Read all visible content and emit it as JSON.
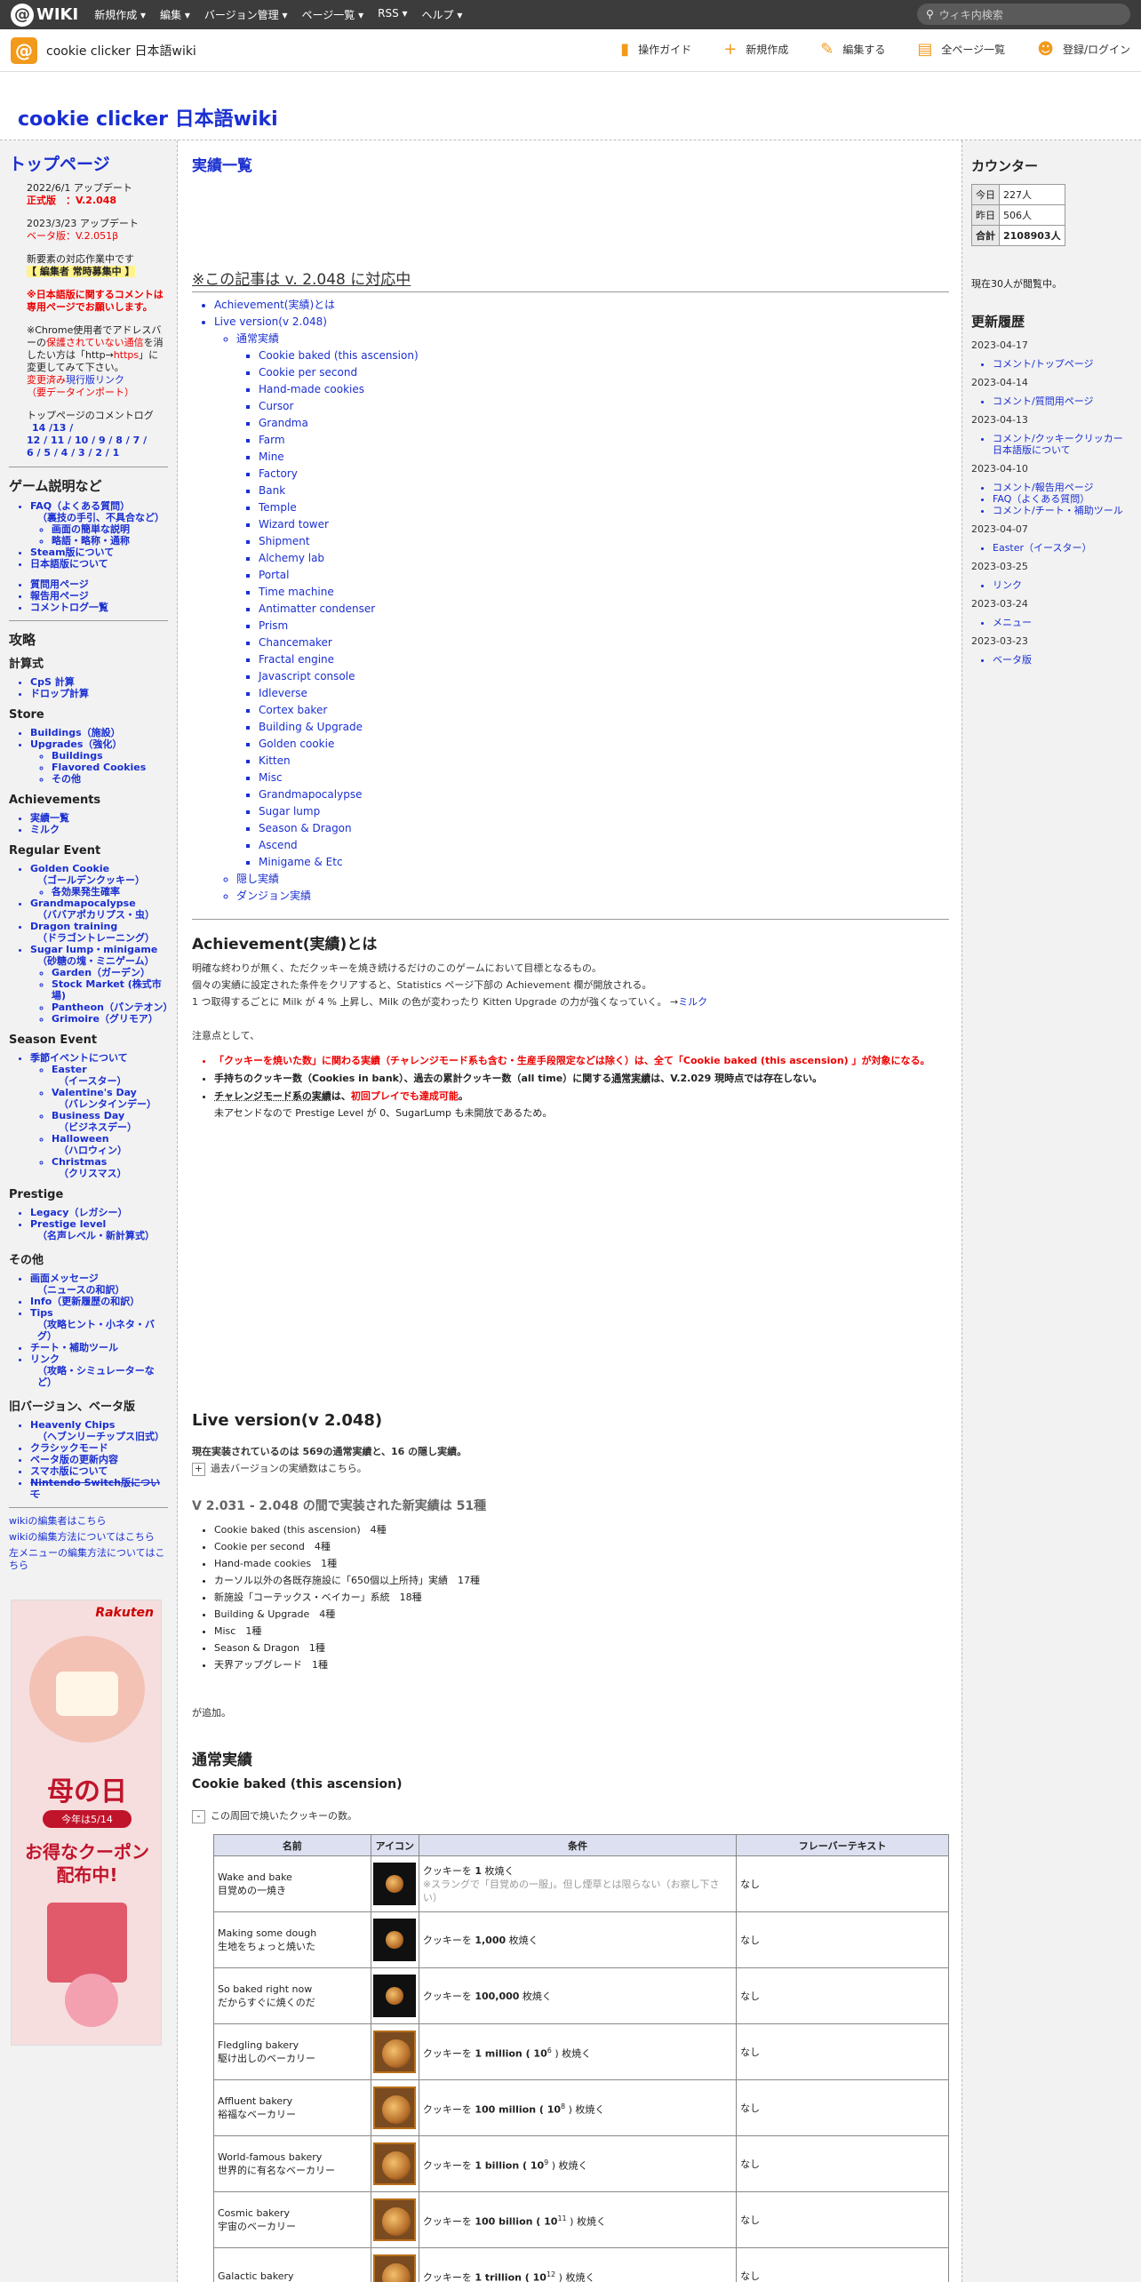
{
  "topbar": {
    "logo": "WIKI",
    "menus": [
      "新規作成 ▾",
      "編集 ▾",
      "バージョン管理 ▾",
      "ページ一覧 ▾",
      "RSS ▾",
      "ヘルプ ▾"
    ],
    "search_placeholder": "ウィキ内検索"
  },
  "sitebar": {
    "name": "cookie clicker 日本語wiki",
    "tools": [
      "操作ガイド",
      "新規作成",
      "編集する",
      "全ページ一覧",
      "登録/ログイン"
    ]
  },
  "header_title": "cookie clicker 日本語wiki",
  "left": {
    "top_title": "トップページ",
    "update1": "2022/6/1 アップデート",
    "official": "正式版　：V.2.048",
    "update2": "2023/3/23 アップデート",
    "beta": "ベータ版：V.2.051β",
    "new_elem": "新要素の対応作業中です",
    "editor": "【 編集者 常時募集中 】",
    "jp_comment": "※日本語版に関するコメントは専用ページでお願いします。",
    "chrome1": "※Chrome使用者でアドレスバーの",
    "chrome_red": "保護されていない通信",
    "chrome2": "を消したい方は「http→",
    "chrome_https": "https",
    "chrome3": "」に変更してみて下さい。",
    "changed": "変更済み",
    "current_link": "現行版リンク",
    "data_import": "（要データインポート）",
    "comment_log": "トップページのコメントログ",
    "log1": "14 /13 /",
    "log2": "12 / 11 / 10 / 9 / 8 / 7 /",
    "log3": "6 / 5 / 4 / 3 / 2 / 1",
    "game_title": "ゲーム説明など",
    "faq": "FAQ（よくある質問）",
    "faq_sub": "（裏技の手引、不具合など）",
    "faq_children": [
      "画面の簡単な説明",
      "略語・略称・通称"
    ],
    "game_items": [
      "Steam版について",
      "日本語版について"
    ],
    "help_items": [
      "質問用ページ",
      "報告用ページ",
      "コメントログ一覧"
    ],
    "strategy": "攻略",
    "calc": "計算式",
    "calc_items": [
      "CpS 計算",
      "ドロップ計算"
    ],
    "store": "Store",
    "store_items": [
      "Buildings（施設）",
      "Upgrades（強化）"
    ],
    "store_children": [
      "Buildings",
      "Flavored Cookies",
      "その他"
    ],
    "achievements": "Achievements",
    "ach_items": [
      "実績一覧",
      "ミルク"
    ],
    "regular": "Regular Event",
    "golden": "Golden Cookie",
    "golden_sub": "（ゴールデンクッキー）",
    "golden_child": "各効果発生確率",
    "grandma": "Grandmapocalypse",
    "grandma_sub": "（ババアポカリプス・虫）",
    "dragon": "Dragon training",
    "dragon_sub": "（ドラゴントレーニング）",
    "sugar": "Sugar lump・minigame",
    "sugar_sub": "（砂糖の塊・ミニゲーム）",
    "sugar_children": [
      "Garden（ガーデン）",
      "Stock Market (株式市場)",
      "Pantheon（パンテオン）",
      "Grimoire（グリモア）"
    ],
    "season": "Season Event",
    "season_item": "季節イベントについて",
    "season_children": [
      {
        "en": "Easter",
        "jp": "（イースター）"
      },
      {
        "en": "Valentine's Day",
        "jp": "（バレンタインデー）"
      },
      {
        "en": "Business Day",
        "jp": "（ビジネスデー）"
      },
      {
        "en": "Halloween",
        "jp": "（ハロウィン）"
      },
      {
        "en": "Christmas",
        "jp": "（クリスマス）"
      }
    ],
    "prestige": "Prestige",
    "legacy": "Legacy（レガシー）",
    "plevel": "Prestige level",
    "plevel_sub": "（名声レベル・新計算式）",
    "other": "その他",
    "screen_msg": "画面メッセージ",
    "screen_msg_sub": "（ニュースの和訳）",
    "info": "Info（更新履歴の和訳）",
    "tips": "Tips",
    "tips_sub": "（攻略ヒント・小ネタ・バグ）",
    "cheat": "チート・補助ツール",
    "link": "リンク",
    "link_sub": "（攻略・シミュレーターなど）",
    "old": "旧バージョン、ベータ版",
    "heavenly": "Heavenly Chips",
    "heavenly_sub": "（ヘブンリーチップス旧式）",
    "old_items": [
      "クラシックモード",
      "ベータ版の更新内容",
      "スマホ版について"
    ],
    "switch": "Nintendo Switch版について",
    "edit1": "wikiの編集者はこちら",
    "edit2": "wikiの編集方法についてはこちら",
    "edit3": "左メニューの編集方法についてはこちら"
  },
  "banner": {
    "brand": "Rakuten",
    "t1": "母の日",
    "t2": "今年は5/14",
    "t3a": "お得なクーポン",
    "t3b": "配布中!"
  },
  "main": {
    "page_title": "実績一覧",
    "notice": "※この記事は v. 2.048 に対応中",
    "toc_top": [
      "Achievement(実績)とは",
      "Live version(v 2.048)"
    ],
    "toc_normal": "通常実績",
    "toc_items": [
      "Cookie baked (this ascension)",
      "Cookie per second",
      "Hand-made cookies",
      "Cursor",
      "Grandma",
      "Farm",
      "Mine",
      "Factory",
      "Bank",
      "Temple",
      "Wizard tower",
      "Shipment",
      "Alchemy lab",
      "Portal",
      "Time machine",
      "Antimatter condenser",
      "Prism",
      "Chancemaker",
      "Fractal engine",
      "Javascript console",
      "Idleverse",
      "Cortex baker",
      "Building & Upgrade",
      "Golden cookie",
      "Kitten",
      "Misc",
      "Grandmapocalypse",
      "Sugar lump",
      "Season & Dragon",
      "Ascend",
      "Minigame & Etc"
    ],
    "toc_rest": [
      "隠し実績",
      "ダンジョン実績"
    ],
    "sec1": "Achievement(実績)とは",
    "p1": "明確な終わりが無く、ただクッキーを焼き続けるだけのこのゲームにおいて目標となるもの。",
    "p2": "個々の実績に設定された条件をクリアすると、Statistics ページ下部の Achievement 欄が開放される。",
    "p3": "1 つ取得するごとに Milk が 4 % 上昇し、Milk の色が変わったり Kitten Upgrade の力が強くなっていく。 →",
    "p3_link": "ミルク",
    "note_head": "注意点として、",
    "n1": "「クッキーを焼いた数」に関わる実績（チャレンジモード系も含む・生産手段限定などは除く）は、全て「Cookie baked (this ascension) 」が対象になる。",
    "n2a": "手持ちのクッキー数（Cookies in bank）、過去の累計クッキー数（all time）に関する",
    "n2b": "通常実績",
    "n2c": "は、V.2.029 現時点では存在しない。",
    "n3a": "チャレンジモード系の実績",
    "n3b": "は、",
    "n3c": "初回プレイでも達成可能",
    "n3d": "。",
    "n3e": "未アセンドなので Prestige Level が 0、SugarLump も未開放であるため。",
    "sec2": "Live version(v 2.048)",
    "live_a": "現在実装されているのは 569の通常実績と、16 の隠し実績。",
    "live_toggle": "+",
    "live_b": "過去バージョンの実績数はこちら。",
    "sub_v": "V 2.031 - 2.048 の間で実装された新実績は 51種",
    "adds": [
      "Cookie baked (this ascension)　4種",
      "Cookie per second　4種",
      "Hand-made cookies　1種",
      "カーソル以外の各既存施設に「650個以上所持」実績　17種",
      "新施設「コーテックス・ベイカー」系統　18種",
      "Building & Upgrade　4種",
      "Misc　1種",
      "Season & Dragon　1種",
      "天界アップグレード　1種"
    ],
    "added": "が追加。",
    "sec3": "通常実績",
    "sec4": "Cookie baked (this ascension)",
    "tbl_toggle": "-",
    "tbl_desc": "この周回で焼いたクッキーの数。",
    "headers": [
      "名前",
      "アイコン",
      "条件",
      "フレーバーテキスト"
    ],
    "rows": [
      {
        "en": "Wake and bake",
        "jp": "目覚めの一焼き",
        "c1": "クッキーを ",
        "cb": "1",
        "c2": " 枚焼く",
        "sup": "",
        "c3": "",
        "extra": "※スラングで「目覚めの一服」。但し煙草とは限らない（お察し下さい）",
        "fl": "なし"
      },
      {
        "en": "Making some dough",
        "jp": "生地をちょっと焼いた",
        "c1": "クッキーを ",
        "cb": "1,000",
        "c2": " 枚焼く",
        "sup": "",
        "c3": "",
        "extra": "",
        "fl": "なし"
      },
      {
        "en": "So baked right now",
        "jp": "だからすぐに焼くのだ",
        "c1": "クッキーを ",
        "cb": "100,000",
        "c2": " 枚焼く",
        "sup": "",
        "c3": "",
        "extra": "",
        "fl": "なし"
      },
      {
        "en": "Fledgling bakery",
        "jp": "駆け出しのベーカリー",
        "c1": "クッキーを ",
        "cb": "1 million ( 10",
        "c2": " ) 枚焼く",
        "sup": "6",
        "c3": "",
        "extra": "",
        "fl": "なし"
      },
      {
        "en": "Affluent bakery",
        "jp": "裕福なベーカリー",
        "c1": "クッキーを ",
        "cb": "100 million ( 10",
        "c2": " ) 枚焼く",
        "sup": "8",
        "c3": "",
        "extra": "",
        "fl": "なし"
      },
      {
        "en": "World-famous bakery",
        "jp": "世界的に有名なベーカリー",
        "c1": "クッキーを ",
        "cb": "1 billion ( 10",
        "c2": " ) 枚焼く",
        "sup": "9",
        "c3": "",
        "extra": "",
        "fl": "なし"
      },
      {
        "en": "Cosmic bakery",
        "jp": "宇宙のベーカリー",
        "c1": "クッキーを ",
        "cb": "100 billion ( 10",
        "c2": " ) 枚焼く",
        "sup": "11",
        "c3": "",
        "extra": "",
        "fl": "なし"
      },
      {
        "en": "Galactic bakery",
        "jp": "",
        "c1": "クッキーを ",
        "cb": "1 trillion ( 10",
        "c2": " ) 枚焼く",
        "sup": "12",
        "c3": "",
        "extra": "",
        "fl": "なし"
      }
    ]
  },
  "right": {
    "counter": "カウンター",
    "rows": [
      {
        "k": "今日",
        "v": "227人"
      },
      {
        "k": "昨日",
        "v": "506人"
      },
      {
        "k": "合計",
        "v": "2108903人"
      }
    ],
    "now": "現在30人が閲覧中。",
    "history": "更新履歴",
    "hist": [
      {
        "date": "2023-04-17",
        "items": [
          "コメント/トップページ"
        ]
      },
      {
        "date": "2023-04-14",
        "items": [
          "コメント/質問用ページ"
        ]
      },
      {
        "date": "2023-04-13",
        "items": [
          "コメント/クッキークリッカー日本語版について"
        ]
      },
      {
        "date": "2023-04-10",
        "items": [
          "コメント/報告用ページ",
          "FAQ（よくある質問）",
          "コメント/チート・補助ツール"
        ]
      },
      {
        "date": "2023-04-07",
        "items": [
          "Easter（イースター）"
        ]
      },
      {
        "date": "2023-03-25",
        "items": [
          "リンク"
        ]
      },
      {
        "date": "2023-03-24",
        "items": [
          "メニュー"
        ]
      },
      {
        "date": "2023-03-23",
        "items": [
          "ベータ版"
        ]
      }
    ]
  }
}
